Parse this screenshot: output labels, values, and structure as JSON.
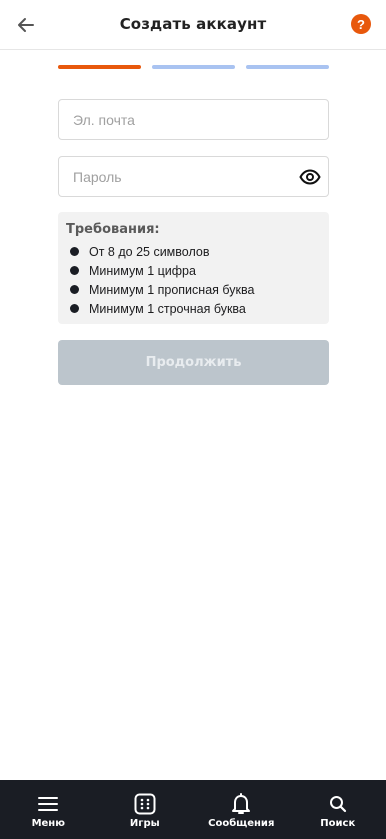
{
  "header": {
    "title": "Создать аккаунт",
    "help_label": "?",
    "back_icon": "arrow-left-icon"
  },
  "progress": {
    "current_step": 1,
    "total_steps": 3
  },
  "form": {
    "email": {
      "placeholder": "Эл. почта",
      "value": ""
    },
    "password": {
      "placeholder": "Пароль",
      "value": ""
    }
  },
  "requirements": {
    "title": "Требования:",
    "items": [
      {
        "label": "От 8 до 25 символов"
      },
      {
        "label": "Минимум 1 цифра"
      },
      {
        "label": "Минимум 1 прописная буква"
      },
      {
        "label": "Минимум 1 строчная буква"
      }
    ]
  },
  "continue_label": "Продолжить",
  "colors": {
    "accent": "#e8580c",
    "step_inactive": "#a9c3f1",
    "button_disabled": "#bcc5cc",
    "nav_background": "#1a1d24"
  },
  "bottom_nav": [
    {
      "label": "Меню",
      "icon": "menu-icon"
    },
    {
      "label": "Игры",
      "icon": "dice-icon"
    },
    {
      "label": "Сообщения",
      "icon": "bell-icon"
    },
    {
      "label": "Поиск",
      "icon": "search-icon"
    }
  ]
}
